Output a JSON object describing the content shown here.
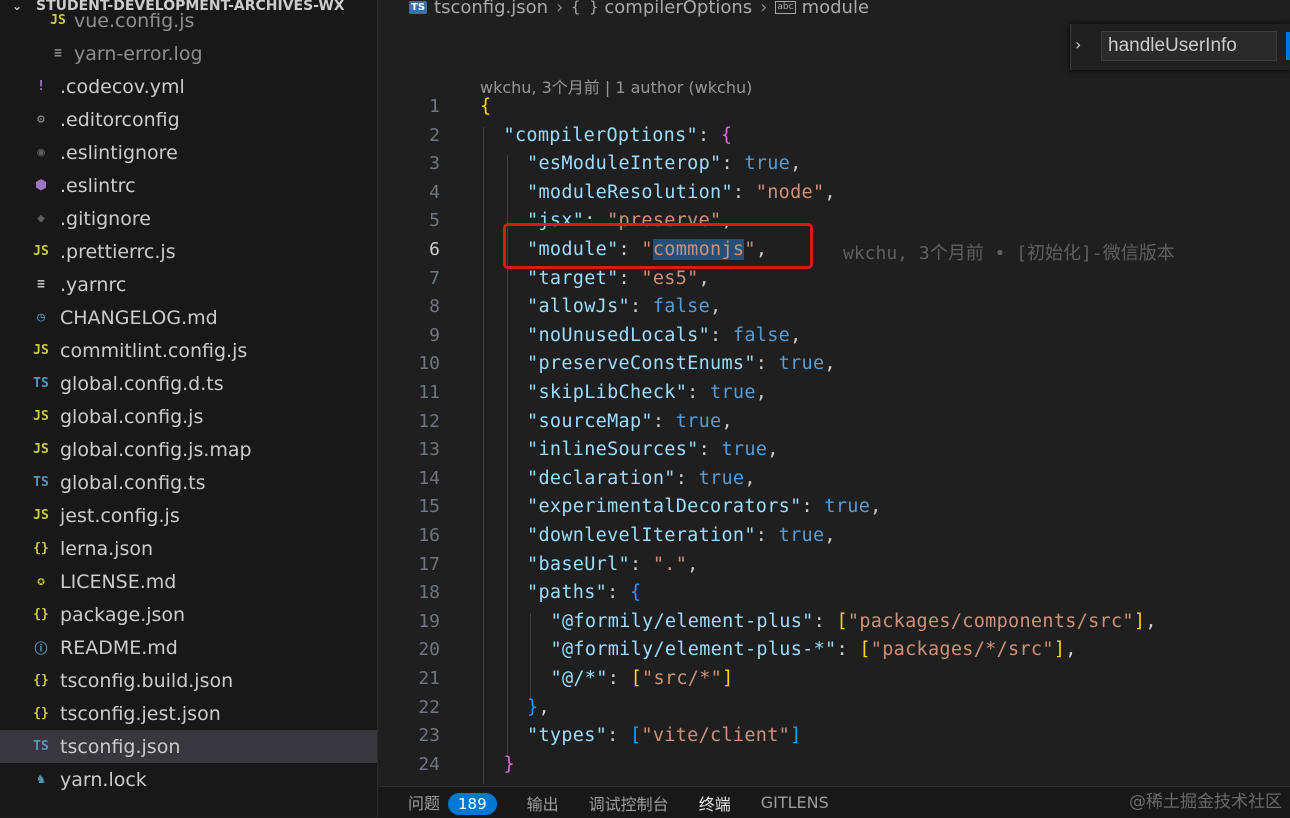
{
  "sidebar": {
    "root_label": "STUDENT-DEVELOPMENT-ARCHIVES-WX",
    "files": [
      {
        "icon": "js-icon",
        "glyph": "JS",
        "color": "#cbcb41",
        "name": "vue.config.js",
        "nested": true
      },
      {
        "icon": "lines-icon",
        "glyph": "≡",
        "color": "#8f8f8f",
        "name": "yarn-error.log",
        "nested": true
      },
      {
        "icon": "exclamation-icon",
        "glyph": "!",
        "color": "#a074c4",
        "name": ".codecov.yml"
      },
      {
        "icon": "gear-icon",
        "glyph": "⚙",
        "color": "#8f8f8f",
        "name": ".editorconfig"
      },
      {
        "icon": "eslint-ignore-icon",
        "glyph": "◉",
        "color": "#5f5f5f",
        "name": ".eslintignore"
      },
      {
        "icon": "eslint-icon",
        "glyph": "⬢",
        "color": "#a074c4",
        "name": ".eslintrc"
      },
      {
        "icon": "git-icon",
        "glyph": "◆",
        "color": "#5f5f5f",
        "name": ".gitignore"
      },
      {
        "icon": "js-icon",
        "glyph": "JS",
        "color": "#cbcb41",
        "name": ".prettierrc.js"
      },
      {
        "icon": "lines-icon",
        "glyph": "≡",
        "color": "#cccccc",
        "name": ".yarnrc"
      },
      {
        "icon": "clock-icon",
        "glyph": "◷",
        "color": "#519aba",
        "name": "CHANGELOG.md"
      },
      {
        "icon": "js-icon",
        "glyph": "JS",
        "color": "#cbcb41",
        "name": "commitlint.config.js"
      },
      {
        "icon": "ts-icon",
        "glyph": "TS",
        "color": "#519aba",
        "name": "global.config.d.ts"
      },
      {
        "icon": "js-icon",
        "glyph": "JS",
        "color": "#cbcb41",
        "name": "global.config.js"
      },
      {
        "icon": "js-icon",
        "glyph": "JS",
        "color": "#cbcb41",
        "name": "global.config.js.map"
      },
      {
        "icon": "ts-icon",
        "glyph": "TS",
        "color": "#519aba",
        "name": "global.config.ts"
      },
      {
        "icon": "js-icon",
        "glyph": "JS",
        "color": "#cbcb41",
        "name": "jest.config.js"
      },
      {
        "icon": "json-icon",
        "glyph": "{}",
        "color": "#cbcb41",
        "name": "lerna.json"
      },
      {
        "icon": "license-icon",
        "glyph": "✪",
        "color": "#cbcb41",
        "name": "LICENSE.md"
      },
      {
        "icon": "json-icon",
        "glyph": "{}",
        "color": "#cbcb41",
        "name": "package.json"
      },
      {
        "icon": "info-icon",
        "glyph": "ⓘ",
        "color": "#519aba",
        "name": "README.md"
      },
      {
        "icon": "json-icon",
        "glyph": "{}",
        "color": "#cbcb41",
        "name": "tsconfig.build.json"
      },
      {
        "icon": "json-icon",
        "glyph": "{}",
        "color": "#cbcb41",
        "name": "tsconfig.jest.json"
      },
      {
        "icon": "tsconfig-icon",
        "glyph": "TS",
        "color": "#519aba",
        "name": "tsconfig.json",
        "selected": true
      },
      {
        "icon": "yarn-icon",
        "glyph": "♞",
        "color": "#519aba",
        "name": "yarn.lock"
      }
    ]
  },
  "breadcrumb": {
    "file": "tsconfig.json",
    "symbol1_glyph": "{ }",
    "symbol1": "compilerOptions",
    "symbol2_glyph": "abc",
    "symbol2": "module"
  },
  "find_widget": {
    "value": "handleUserInfo"
  },
  "blame_header": "wkchu, 3个月前 | 1 author (wkchu)",
  "inline_blame": "wkchu, 3个月前 • [初始化]-微信版本",
  "active_line": 6,
  "code_lines": [
    {
      "n": 1,
      "indent": 0,
      "tokens": [
        [
          "br1",
          "{"
        ]
      ]
    },
    {
      "n": 2,
      "indent": 1,
      "tokens": [
        [
          "k",
          "\"compilerOptions\""
        ],
        [
          "p",
          ": "
        ],
        [
          "br2",
          "{"
        ]
      ]
    },
    {
      "n": 3,
      "indent": 2,
      "tokens": [
        [
          "k",
          "\"esModuleInterop\""
        ],
        [
          "p",
          ": "
        ],
        [
          "b",
          "true"
        ],
        [
          "p",
          ","
        ]
      ]
    },
    {
      "n": 4,
      "indent": 2,
      "tokens": [
        [
          "k",
          "\"moduleResolution\""
        ],
        [
          "p",
          ": "
        ],
        [
          "s",
          "\"node\""
        ],
        [
          "p",
          ","
        ]
      ]
    },
    {
      "n": 5,
      "indent": 2,
      "tokens": [
        [
          "k",
          "\"jsx\""
        ],
        [
          "p",
          ": "
        ],
        [
          "s",
          "\"preserve\""
        ],
        [
          "p",
          ","
        ]
      ]
    },
    {
      "n": 6,
      "indent": 2,
      "tokens": [
        [
          "k",
          "\"module\""
        ],
        [
          "p",
          ": "
        ],
        [
          "s",
          "\""
        ],
        [
          "sel",
          "commonjs"
        ],
        [
          "s",
          "\""
        ],
        [
          "p",
          ","
        ]
      ]
    },
    {
      "n": 7,
      "indent": 2,
      "tokens": [
        [
          "k",
          "\"target\""
        ],
        [
          "p",
          ": "
        ],
        [
          "s",
          "\"es5\""
        ],
        [
          "p",
          ","
        ]
      ]
    },
    {
      "n": 8,
      "indent": 2,
      "tokens": [
        [
          "k",
          "\"allowJs\""
        ],
        [
          "p",
          ": "
        ],
        [
          "b",
          "false"
        ],
        [
          "p",
          ","
        ]
      ]
    },
    {
      "n": 9,
      "indent": 2,
      "tokens": [
        [
          "k",
          "\"noUnusedLocals\""
        ],
        [
          "p",
          ": "
        ],
        [
          "b",
          "false"
        ],
        [
          "p",
          ","
        ]
      ]
    },
    {
      "n": 10,
      "indent": 2,
      "tokens": [
        [
          "k",
          "\"preserveConstEnums\""
        ],
        [
          "p",
          ": "
        ],
        [
          "b",
          "true"
        ],
        [
          "p",
          ","
        ]
      ]
    },
    {
      "n": 11,
      "indent": 2,
      "tokens": [
        [
          "k",
          "\"skipLibCheck\""
        ],
        [
          "p",
          ": "
        ],
        [
          "b",
          "true"
        ],
        [
          "p",
          ","
        ]
      ]
    },
    {
      "n": 12,
      "indent": 2,
      "tokens": [
        [
          "k",
          "\"sourceMap\""
        ],
        [
          "p",
          ": "
        ],
        [
          "b",
          "true"
        ],
        [
          "p",
          ","
        ]
      ]
    },
    {
      "n": 13,
      "indent": 2,
      "tokens": [
        [
          "k",
          "\"inlineSources\""
        ],
        [
          "p",
          ": "
        ],
        [
          "b",
          "true"
        ],
        [
          "p",
          ","
        ]
      ]
    },
    {
      "n": 14,
      "indent": 2,
      "tokens": [
        [
          "k",
          "\"declaration\""
        ],
        [
          "p",
          ": "
        ],
        [
          "b",
          "true"
        ],
        [
          "p",
          ","
        ]
      ]
    },
    {
      "n": 15,
      "indent": 2,
      "tokens": [
        [
          "k",
          "\"experimentalDecorators\""
        ],
        [
          "p",
          ": "
        ],
        [
          "b",
          "true"
        ],
        [
          "p",
          ","
        ]
      ]
    },
    {
      "n": 16,
      "indent": 2,
      "tokens": [
        [
          "k",
          "\"downlevelIteration\""
        ],
        [
          "p",
          ": "
        ],
        [
          "b",
          "true"
        ],
        [
          "p",
          ","
        ]
      ]
    },
    {
      "n": 17,
      "indent": 2,
      "tokens": [
        [
          "k",
          "\"baseUrl\""
        ],
        [
          "p",
          ": "
        ],
        [
          "s",
          "\".\""
        ],
        [
          "p",
          ","
        ]
      ]
    },
    {
      "n": 18,
      "indent": 2,
      "tokens": [
        [
          "k",
          "\"paths\""
        ],
        [
          "p",
          ": "
        ],
        [
          "br3",
          "{"
        ]
      ]
    },
    {
      "n": 19,
      "indent": 3,
      "tokens": [
        [
          "k",
          "\"@formily/element-plus\""
        ],
        [
          "p",
          ": "
        ],
        [
          "br1",
          "["
        ],
        [
          "s",
          "\"packages/components/src\""
        ],
        [
          "br1",
          "]"
        ],
        [
          "p",
          ","
        ]
      ]
    },
    {
      "n": 20,
      "indent": 3,
      "tokens": [
        [
          "k",
          "\"@formily/element-plus-*\""
        ],
        [
          "p",
          ": "
        ],
        [
          "br1",
          "["
        ],
        [
          "s",
          "\"packages/*/src\""
        ],
        [
          "br1",
          "]"
        ],
        [
          "p",
          ","
        ]
      ]
    },
    {
      "n": 21,
      "indent": 3,
      "tokens": [
        [
          "k",
          "\"@/*\""
        ],
        [
          "p",
          ": "
        ],
        [
          "br1",
          "["
        ],
        [
          "s",
          "\"src/*\""
        ],
        [
          "br1",
          "]"
        ]
      ]
    },
    {
      "n": 22,
      "indent": 2,
      "tokens": [
        [
          "br3",
          "}"
        ],
        [
          "p",
          ","
        ]
      ]
    },
    {
      "n": 23,
      "indent": 2,
      "tokens": [
        [
          "k",
          "\"types\""
        ],
        [
          "p",
          ": "
        ],
        [
          "br3",
          "["
        ],
        [
          "s",
          "\"vite/client\""
        ],
        [
          "br3",
          "]"
        ]
      ]
    },
    {
      "n": 24,
      "indent": 1,
      "tokens": [
        [
          "br2",
          "}"
        ]
      ]
    }
  ],
  "panel": {
    "tabs": [
      "问题",
      "输出",
      "调试控制台",
      "终端",
      "GITLENS"
    ],
    "problems_count": "189",
    "active_tab": "终端"
  },
  "watermark": "@稀土掘金技术社区",
  "colors": {
    "accent": "#0078d4",
    "highlight_box": "#e8121c",
    "selection": "#264f78"
  }
}
